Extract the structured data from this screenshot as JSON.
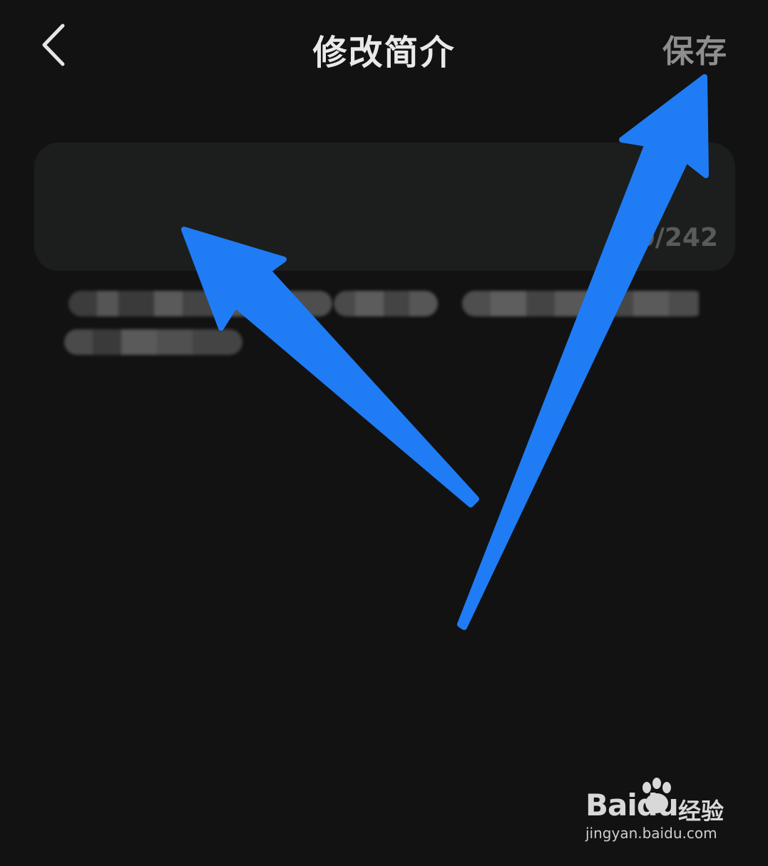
{
  "header": {
    "title": "修改简介",
    "save_label": "保存",
    "back_icon": "chevron-left-icon"
  },
  "intro_editor": {
    "value": "",
    "char_counter": "0/242"
  },
  "hint": {
    "text_blurred": true
  },
  "annotations": {
    "arrow_color": "#1f7cf5",
    "count": 2
  },
  "watermark": {
    "brand": "Baidu",
    "suffix": "经验",
    "url": "jingyan.baidu.com"
  },
  "colors": {
    "background": "#121212",
    "input_box": "#1b1e1c",
    "title_text": "#e9e9e9",
    "save_text": "#8e8e8e",
    "counter_text": "#5a5a5a"
  }
}
